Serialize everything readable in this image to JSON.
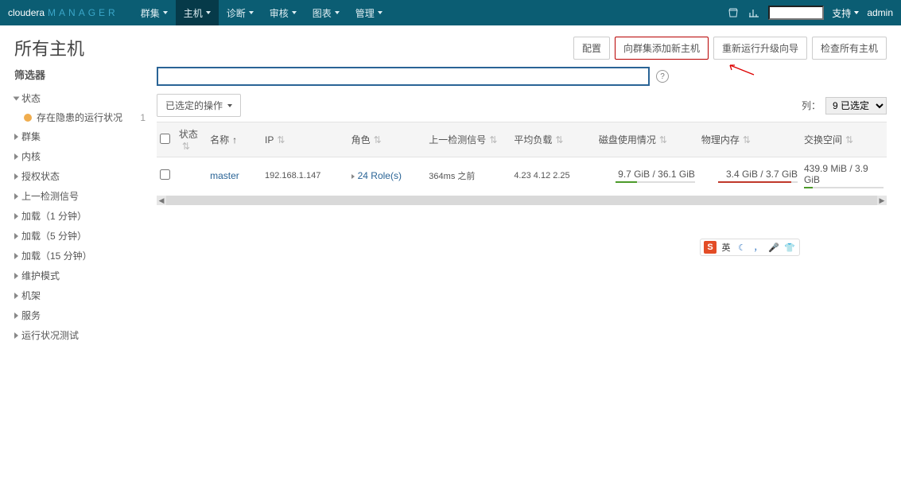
{
  "nav": {
    "brand_a": "cloudera",
    "brand_b": "MANAGER",
    "items": [
      "群集",
      "主机",
      "诊断",
      "审核",
      "图表",
      "管理"
    ],
    "active": 1,
    "support": "支持",
    "admin": "admin"
  },
  "page": {
    "title": "所有主机",
    "btn_config": "配置",
    "btn_addhosts": "向群集添加新主机",
    "btn_rerun": "重新运行升级向导",
    "btn_inspect": "检查所有主机"
  },
  "sidebar": {
    "filter_title": "筛选器",
    "status_section": "状态",
    "status_item": "存在隐患的运行状况",
    "status_count": "1",
    "others": [
      "群集",
      "内核",
      "授权状态",
      "上一检测信号",
      "加载（1 分钟）",
      "加载（5 分钟）",
      "加载（15 分钟）",
      "维护模式",
      "机架",
      "服务",
      "运行状况测试"
    ]
  },
  "toolbar": {
    "selected_actions": "已选定的操作",
    "columns_label": "列：",
    "columns_value": "9 已选定"
  },
  "table": {
    "headers": [
      "",
      "状态",
      "名称",
      "IP",
      "角色",
      "上一检测信号",
      "平均负载",
      "磁盘使用情况",
      "物理内存",
      "交换空间"
    ],
    "row": {
      "name": "master",
      "ip": "192.168.1.147",
      "roles": "24 Role(s)",
      "heartbeat": "364ms 之前",
      "load": "4.23  4.12  2.25",
      "disk": "9.7 GiB / 36.1 GiB",
      "memory": "3.4 GiB / 3.7 GiB",
      "swap": "439.9 MiB / 3.9 GiB"
    }
  },
  "ime": {
    "s": "S",
    "lang": "英"
  }
}
